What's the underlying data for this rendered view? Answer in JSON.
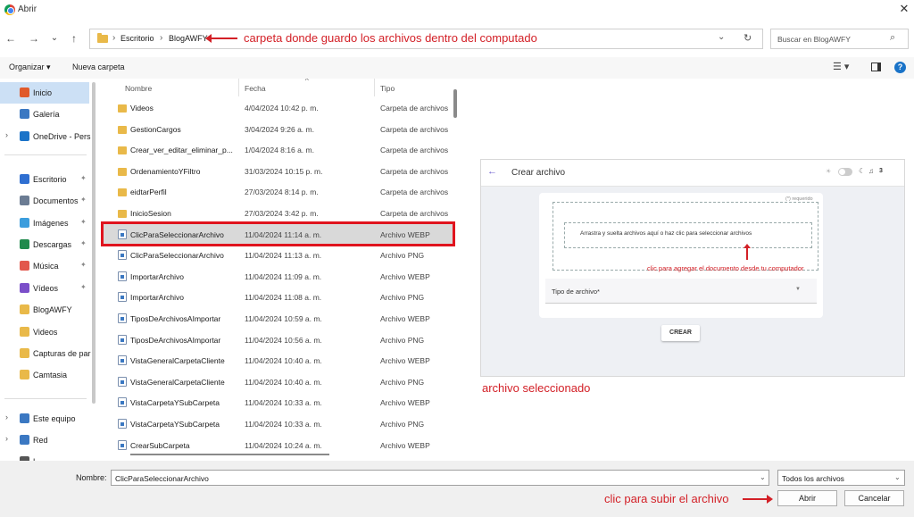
{
  "window": {
    "title": "Abrir",
    "close": "✕"
  },
  "nav": {
    "back": "←",
    "forward": "→",
    "recent": "⌄",
    "up": "↑"
  },
  "address": {
    "sep": "›",
    "crumbs": [
      "Escritorio",
      "BlogAWFY"
    ],
    "dropdown": "⌄",
    "refresh": "↻"
  },
  "search": {
    "placeholder": "Buscar en BlogAWFY",
    "icon": "🔍"
  },
  "toolbar": {
    "organize": "Organizar ▾",
    "new_folder": "Nueva carpeta",
    "view": "☰ ▾",
    "help": "?"
  },
  "sidebar": {
    "items": [
      {
        "label": "Inicio",
        "icon": "home-icon",
        "color": "#e05a2b"
      },
      {
        "label": "Galería",
        "icon": "gallery-icon",
        "color": "#3b78c2"
      },
      {
        "label": "OneDrive - Pers",
        "icon": "cloud-icon",
        "color": "#1a73c8"
      },
      {
        "label": "Escritorio",
        "icon": "desktop-icon",
        "color": "#2f6fd1"
      },
      {
        "label": "Documentos",
        "icon": "documents-icon",
        "color": "#6b7c93"
      },
      {
        "label": "Imágenes",
        "icon": "pictures-icon",
        "color": "#3b9ddd"
      },
      {
        "label": "Descargas",
        "icon": "downloads-icon",
        "color": "#1f8a4c"
      },
      {
        "label": "Música",
        "icon": "music-icon",
        "color": "#e2574c"
      },
      {
        "label": "Vídeos",
        "icon": "videos-icon",
        "color": "#7b4fc9"
      },
      {
        "label": "BlogAWFY",
        "icon": "folder-icon",
        "color": "#e9b949"
      },
      {
        "label": "Videos",
        "icon": "folder-icon",
        "color": "#e9b949"
      },
      {
        "label": "Capturas de par",
        "icon": "folder-icon",
        "color": "#e9b949"
      },
      {
        "label": "Camtasia",
        "icon": "folder-icon",
        "color": "#e9b949"
      },
      {
        "label": "Este equipo",
        "icon": "computer-icon",
        "color": "#3b78c2"
      },
      {
        "label": "Red",
        "icon": "network-icon",
        "color": "#3b78c2"
      },
      {
        "label": "L",
        "icon": "linux-icon",
        "color": "#555555"
      }
    ],
    "pin": "📌",
    "caret": "›"
  },
  "columns": {
    "name": "Nombre",
    "date": "Fecha",
    "type": "Tipo",
    "sort": "^"
  },
  "files": [
    {
      "name": "Videos",
      "date": "4/04/2024 10:42 p. m.",
      "type": "Carpeta de archivos",
      "kind": "folder"
    },
    {
      "name": "GestionCargos",
      "date": "3/04/2024 9:26 a. m.",
      "type": "Carpeta de archivos",
      "kind": "folder"
    },
    {
      "name": "Crear_ver_editar_eliminar_p...",
      "date": "1/04/2024 8:16 a. m.",
      "type": "Carpeta de archivos",
      "kind": "folder"
    },
    {
      "name": "OrdenamientoYFiltro",
      "date": "31/03/2024 10:15 p. m.",
      "type": "Carpeta de archivos",
      "kind": "folder"
    },
    {
      "name": "eidtarPerfil",
      "date": "27/03/2024 8:14 p. m.",
      "type": "Carpeta de archivos",
      "kind": "folder"
    },
    {
      "name": "InicioSesion",
      "date": "27/03/2024 3:42 p. m.",
      "type": "Carpeta de archivos",
      "kind": "folder"
    },
    {
      "name": "ClicParaSeleccionarArchivo",
      "date": "11/04/2024 11:14 a. m.",
      "type": "Archivo WEBP",
      "kind": "file",
      "selected": true
    },
    {
      "name": "ClicParaSeleccionarArchivo",
      "date": "11/04/2024 11:13 a. m.",
      "type": "Archivo PNG",
      "kind": "file"
    },
    {
      "name": "ImportarArchivo",
      "date": "11/04/2024 11:09 a. m.",
      "type": "Archivo WEBP",
      "kind": "file"
    },
    {
      "name": "ImportarArchivo",
      "date": "11/04/2024 11:08 a. m.",
      "type": "Archivo PNG",
      "kind": "file"
    },
    {
      "name": "TiposDeArchivosAImportar",
      "date": "11/04/2024 10:59 a. m.",
      "type": "Archivo WEBP",
      "kind": "file"
    },
    {
      "name": "TiposDeArchivosAImportar",
      "date": "11/04/2024 10:56 a. m.",
      "type": "Archivo PNG",
      "kind": "file"
    },
    {
      "name": "VistaGeneralCarpetaCliente",
      "date": "11/04/2024 10:40 a. m.",
      "type": "Archivo WEBP",
      "kind": "file"
    },
    {
      "name": "VistaGeneralCarpetaCliente",
      "date": "11/04/2024 10:40 a. m.",
      "type": "Archivo PNG",
      "kind": "file"
    },
    {
      "name": "VistaCarpetaYSubCarpeta",
      "date": "11/04/2024 10:33 a. m.",
      "type": "Archivo WEBP",
      "kind": "file"
    },
    {
      "name": "VistaCarpetaYSubCarpeta",
      "date": "11/04/2024 10:33 a. m.",
      "type": "Archivo PNG",
      "kind": "file"
    },
    {
      "name": "CrearSubCarpeta",
      "date": "11/04/2024 10:24 a. m.",
      "type": "Archivo WEBP",
      "kind": "file"
    }
  ],
  "preview": {
    "back": "←",
    "title": "Crear archivo",
    "sun": "☀",
    "moon": "☾",
    "bell": "🔔",
    "count": "3",
    "required": "(*) requerido",
    "dropzone_text": "Arrastra y suelta archivos aquí o haz clic para seleccionar archivos",
    "annotation": "clic para agregar el documento desde tu computador",
    "select_label": "Tipo de archivo*",
    "select_caret": "▼",
    "create_button": "CREAR"
  },
  "annotations": {
    "address": "carpeta donde guardo los archivos dentro del computado",
    "preview": "archivo seleccionado",
    "open": "clic para subir el archivo"
  },
  "footer": {
    "name_label": "Nombre:",
    "name_value": "ClicParaSeleccionarArchivo",
    "filter_value": "Todos los archivos",
    "caret": "⌄",
    "open_button": "Abrir",
    "cancel_button": "Cancelar"
  },
  "colors": {
    "annotation": "#d32027",
    "selection": "#d9d9d9",
    "sidebar_active": "#cce0f5"
  }
}
